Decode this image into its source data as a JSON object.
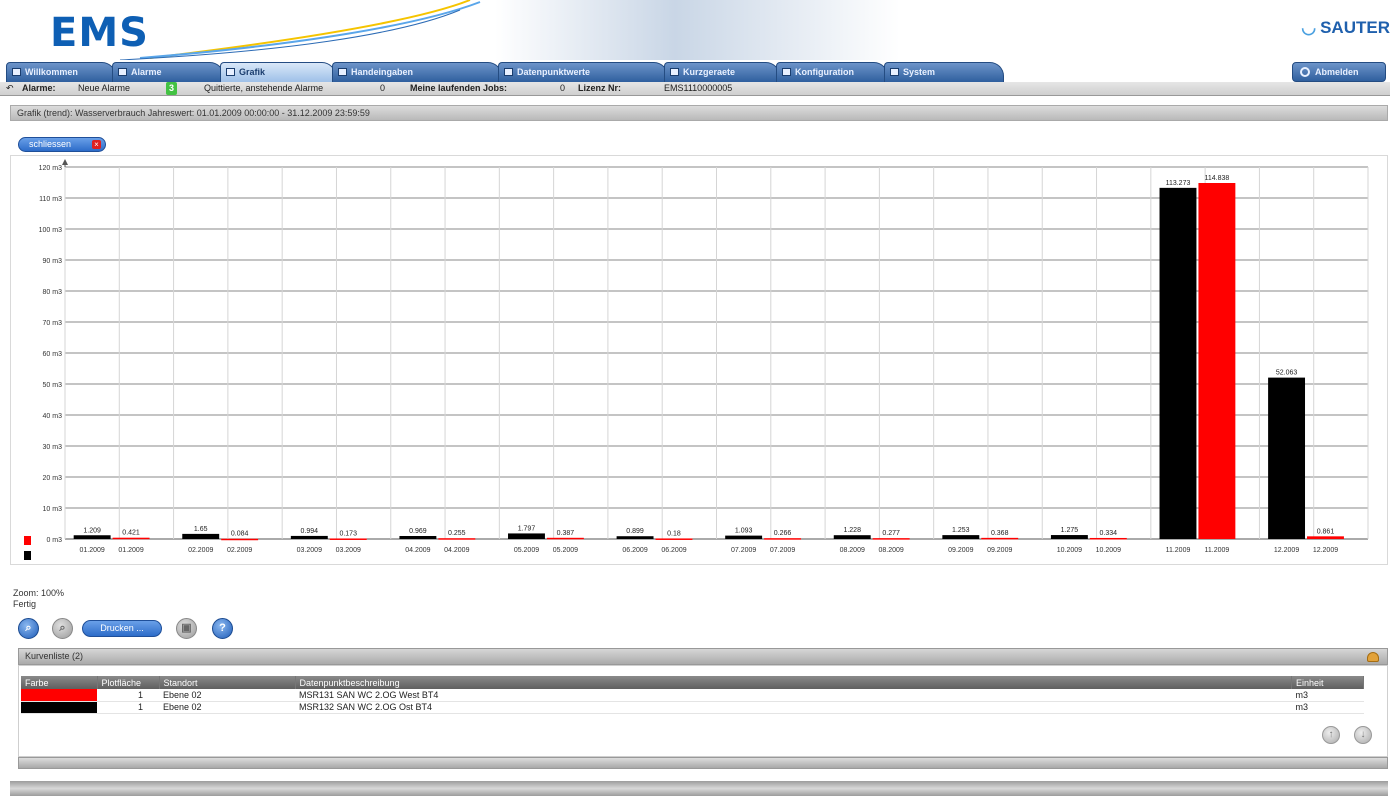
{
  "app": {
    "logo": "EMS",
    "vendor": "SAUTER"
  },
  "tabs": [
    {
      "label": "Willkommen",
      "icon": "home-icon",
      "active": false
    },
    {
      "label": "Alarme",
      "icon": "alarm-icon",
      "active": false
    },
    {
      "label": "Grafik",
      "icon": "chart-icon",
      "active": true
    },
    {
      "label": "Handeingaben",
      "icon": "input-icon",
      "active": false
    },
    {
      "label": "Datenpunktwerte",
      "icon": "datapoint-icon",
      "active": false
    },
    {
      "label": "Kurzgeraete",
      "icon": "device-icon",
      "active": false
    },
    {
      "label": "Konfiguration",
      "icon": "config-icon",
      "active": false
    },
    {
      "label": "System",
      "icon": "system-icon",
      "active": false
    }
  ],
  "logout_label": "Abmelden",
  "status": {
    "alarms_label": "Alarme:",
    "new_alarms_label": "Neue Alarme",
    "new_alarms_count": "3",
    "acknowledged_label": "Quittierte, anstehende Alarme",
    "acknowledged_count": "0",
    "jobs_label": "Meine laufenden Jobs:",
    "jobs_count": "0",
    "license_label": "Lizenz Nr:",
    "license_value": "EMS1110000005"
  },
  "view_title": "Grafik (trend): Wasserverbrauch Jahreswert: 01.01.2009 00:00:00 - 31.12.2009 23:59:59",
  "close_label": "schliessen",
  "zoom_label": "Zoom: 100%",
  "status_text": "Fertig",
  "print_label": "Drucken ...",
  "panel_title": "Kurvenliste (2)",
  "table": {
    "headers": [
      "Farbe",
      "Plotfläche",
      "Standort",
      "Datenpunktbeschreibung",
      "Einheit"
    ],
    "rows": [
      {
        "color": "#ff0000",
        "plot": "1",
        "location": "Ebene 02",
        "description": "MSR131 SAN WC 2.OG West BT4",
        "unit": "m3"
      },
      {
        "color": "#000000",
        "plot": "1",
        "location": "Ebene 02",
        "description": "MSR132 SAN WC 2.OG Ost BT4",
        "unit": "m3"
      }
    ]
  },
  "chart_data": {
    "type": "bar",
    "unit": "m3",
    "ylim": [
      0,
      120
    ],
    "y_ticks": [
      "0 m3",
      "10 m3",
      "20 m3",
      "30 m3",
      "40 m3",
      "50 m3",
      "60 m3",
      "70 m3",
      "80 m3",
      "90 m3",
      "100 m3",
      "110 m3",
      "120 m3"
    ],
    "series": [
      {
        "color": "#000000",
        "labels": [
          "1.209",
          "1.65",
          "0.994",
          "0.969",
          "1.797",
          "0.899",
          "1.093",
          "1.228",
          "1.253",
          "1.275",
          "113.273",
          "52.063"
        ],
        "values": [
          1.209,
          1.65,
          0.994,
          0.969,
          1.797,
          0.899,
          1.093,
          1.228,
          1.253,
          1.275,
          113.273,
          52.063
        ],
        "categories": [
          "01.2009",
          "02.2009",
          "03.2009",
          "04.2009",
          "05.2009",
          "06.2009",
          "07.2009",
          "08.2009",
          "09.2009",
          "10.2009",
          "11.2009",
          "12.2009"
        ]
      },
      {
        "color": "#ff0000",
        "labels": [
          "0.421",
          "0.084",
          "0.173",
          "0.255",
          "0.387",
          "0.18",
          "0.266",
          "0.277",
          "0.368",
          "0.334",
          "114.838",
          "0.861"
        ],
        "values": [
          0.421,
          0.084,
          0.173,
          0.255,
          0.387,
          0.18,
          0.266,
          0.277,
          0.368,
          0.334,
          114.838,
          0.861
        ],
        "categories": [
          "01.2009",
          "02.2009",
          "03.2009",
          "04.2009",
          "05.2009",
          "06.2009",
          "07.2009",
          "08.2009",
          "09.2009",
          "10.2009",
          "11.2009",
          "12.2009"
        ]
      }
    ],
    "grid": true,
    "legend": "bottom-left"
  }
}
